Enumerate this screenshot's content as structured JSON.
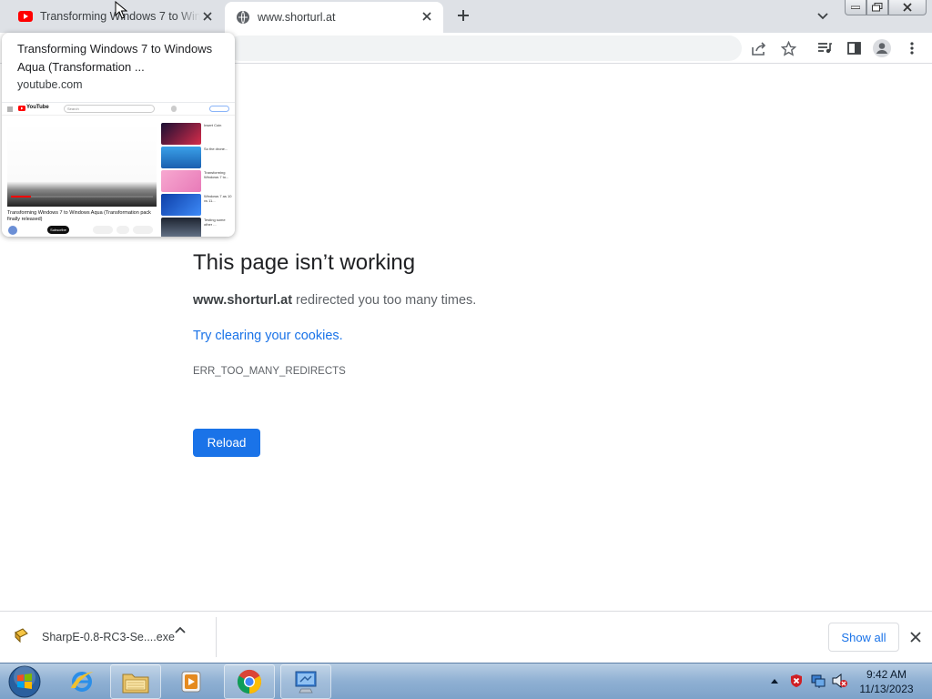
{
  "tabs": [
    {
      "title": "Transforming Windows 7 to Windows Aqua (Transformation pack finally released)",
      "active": false,
      "favicon": "youtube-icon"
    },
    {
      "title": "www.shorturl.at",
      "active": true,
      "favicon": "globe-icon"
    }
  ],
  "hover_card": {
    "title": "Transforming Windows 7 to Windows Aqua (Transformation ...",
    "domain": "youtube.com",
    "thumbnail": {
      "logo": "YouTube",
      "search_placeholder": "Search",
      "video_title": "Transforming Windows 7 to Windows Aqua (Transformation pack finally released)",
      "subscribe_label": "Subscribe",
      "sidebar_items": [
        "Insert Coin",
        "So the drone...",
        "Transforming Windows 7 to...",
        "Windows 7 as 10 vs 11...",
        "Testing some other ..."
      ]
    }
  },
  "error": {
    "title": "This page isn’t working",
    "host": "www.shorturl.at",
    "message_rest": " redirected you too many times.",
    "link": "Try clearing your cookies",
    "link_suffix": ".",
    "code": "ERR_TOO_MANY_REDIRECTS",
    "reload_label": "Reload"
  },
  "downloads": {
    "file_name": "SharpE-0.8-RC3-Se....exe",
    "show_all_label": "Show all"
  },
  "taskbar": {
    "apps": [
      "internet-explorer-icon",
      "file-explorer-icon",
      "media-player-icon",
      "chrome-icon",
      "control-panel-icon"
    ],
    "time": "9:42 AM",
    "date": "11/13/2023"
  },
  "colors": {
    "accent": "#1a73e8",
    "tabstrip": "#dee1e6",
    "youtube_red": "#ff0000"
  }
}
